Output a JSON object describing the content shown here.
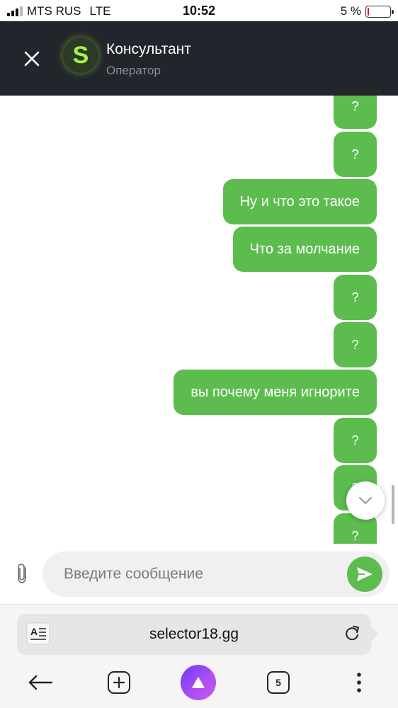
{
  "status_bar": {
    "carrier": "MTS RUS",
    "network": "LTE",
    "time": "10:52",
    "battery_percent": "5 %",
    "battery_level": 0.05,
    "signal_bars_active": 3
  },
  "header": {
    "avatar_letter": "S",
    "title": "Консультант",
    "subtitle": "Оператор"
  },
  "messages": [
    {
      "text": "?"
    },
    {
      "text": "?"
    },
    {
      "text": "Ну и что это такое"
    },
    {
      "text": "Что за молчание"
    },
    {
      "text": "?"
    },
    {
      "text": "?"
    },
    {
      "text": "вы почему меня игноритe"
    },
    {
      "text": "?"
    },
    {
      "text": "?"
    },
    {
      "text": "?"
    }
  ],
  "composer": {
    "placeholder": "Введите сообщение"
  },
  "browser": {
    "url": "selector18.gg",
    "tabs_count": "5"
  },
  "colors": {
    "header_bg": "#23252c",
    "bubble_green": "#5cbd4e",
    "avatar_green": "#a6f045",
    "battery_red": "#ee1111",
    "alice_purple": "#8a44f4"
  }
}
